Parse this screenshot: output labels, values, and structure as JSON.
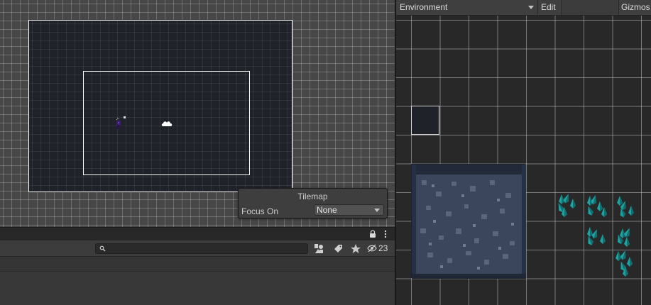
{
  "scene": {
    "overlay": {
      "title": "Tilemap",
      "focus_label": "Focus On",
      "focus_value": "None"
    }
  },
  "hierarchy": {
    "hidden_count": "23"
  },
  "palette": {
    "palette_name": "Environment",
    "edit_label": "Edit",
    "gizmos_label": "Gizmos"
  },
  "icons": {
    "scene_overlay": [
      "player-sprite-icon",
      "cloud-icon"
    ],
    "bottom_tabbar": [
      "lock-icon",
      "kebab-menu-icon"
    ],
    "search_toolbar": [
      "search-icon",
      "scene-visibility-icon",
      "label-icon",
      "star-icon",
      "hidden-eye-icon"
    ],
    "palette": [
      "chevron-down-icon",
      "stone-tile-icon",
      "crystal-tile-icon"
    ]
  },
  "colors": {
    "camera_bg": "#20222a",
    "scene_grid": "#474747",
    "panel_bg": "#282828",
    "stone_tile": "#2c3548",
    "crystal": "#1fa3a0"
  }
}
